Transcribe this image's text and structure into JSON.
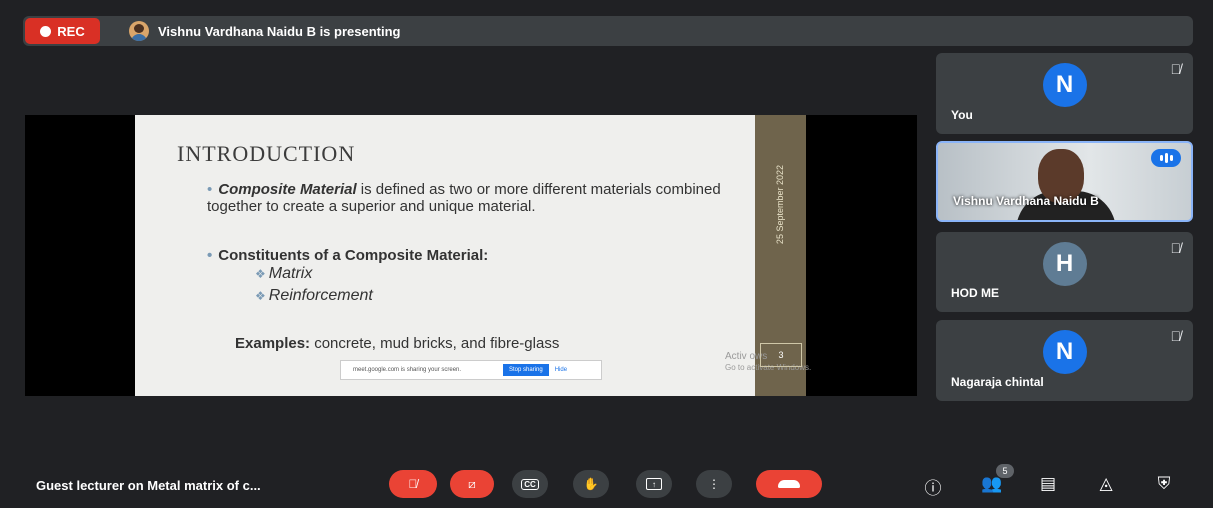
{
  "top_bar": {
    "rec_label": "REC",
    "presenting_text": "Vishnu Vardhana Naidu B is presenting"
  },
  "slide": {
    "title": "INTRODUCTION",
    "bullet_definition_term": "Composite Material",
    "bullet_definition_rest": " is defined as two or more different materials combined together to create a superior and unique material.",
    "bullet_constituents": "Constituents of a Composite Material:",
    "sub_items": [
      "Matrix",
      "Reinforcement"
    ],
    "examples_label": "Examples:",
    "examples_text": " concrete, mud bricks, and fibre-glass",
    "band_date": "25 September 2022",
    "page_number": "3",
    "share_notice": "meet.google.com is sharing your screen.",
    "stop_sharing": "Stop sharing",
    "hide": "Hide",
    "activate_line1": "Activ      ows",
    "activate_line2": "Go to          activate Windows."
  },
  "participants": [
    {
      "name": "You",
      "initial": "N",
      "avatar_color": "#1a73e8",
      "muted": true
    },
    {
      "name": "Vishnu Vardhana Naidu B",
      "video": true,
      "speaking": true
    },
    {
      "name": "HOD ME",
      "initial": "H",
      "avatar_color": "#5f7c94",
      "muted": true
    },
    {
      "name": "Nagaraja chintal",
      "initial": "N",
      "avatar_color": "#1a73e8",
      "muted": true
    }
  ],
  "bottom_bar": {
    "meeting_title": "Guest lecturer on Metal matrix of c...",
    "cc_label": "CC",
    "people_count": "5"
  },
  "colors": {
    "background": "#202124",
    "rec_red": "#d93025",
    "hangup_red": "#ea4335",
    "accent_blue": "#1a73e8"
  },
  "icons": [
    "mic-off-icon",
    "camera-off-icon",
    "captions-icon",
    "raise-hand-icon",
    "present-icon",
    "more-options-icon",
    "hang-up-icon",
    "info-icon",
    "people-icon",
    "chat-icon",
    "activities-icon",
    "host-controls-icon"
  ]
}
